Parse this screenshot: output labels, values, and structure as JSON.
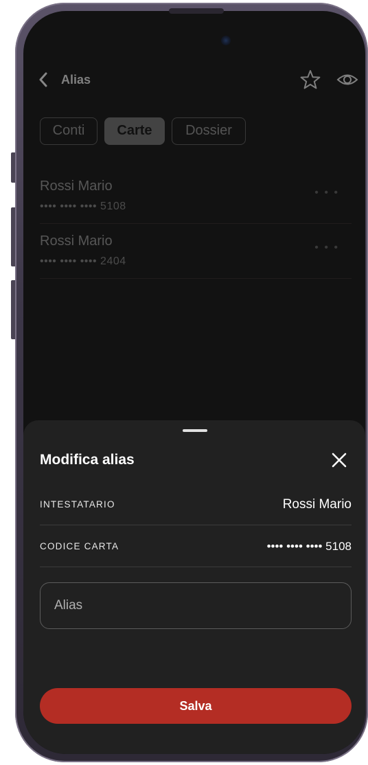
{
  "header": {
    "back_icon": "chevron-left-icon",
    "title": "Alias",
    "favorite_icon": "star-outline-icon",
    "visibility_icon": "eye-icon"
  },
  "tabs": [
    {
      "label": "Conti",
      "active": false
    },
    {
      "label": "Carte",
      "active": true
    },
    {
      "label": "Dossier",
      "active": false
    }
  ],
  "cards": [
    {
      "name": "Rossi Mario",
      "number": "•••• •••• •••• 5108",
      "more_icon": "more-horizontal-icon"
    },
    {
      "name": "Rossi Mario",
      "number": "•••• •••• •••• 2404",
      "more_icon": "more-horizontal-icon"
    }
  ],
  "sheet": {
    "title": "Modifica alias",
    "close_icon": "close-icon",
    "holder_label": "INTESTATARIO",
    "holder_value": "Rossi Mario",
    "card_code_label": "CODICE CARTA",
    "card_code_value": "•••• •••• •••• 5108",
    "alias_placeholder": "Alias",
    "alias_value": "",
    "save_label": "Salva"
  },
  "colors": {
    "background": "#121212",
    "sheet": "#212121",
    "accent": "#b42d24",
    "active_tab": "#6c6c6c"
  }
}
